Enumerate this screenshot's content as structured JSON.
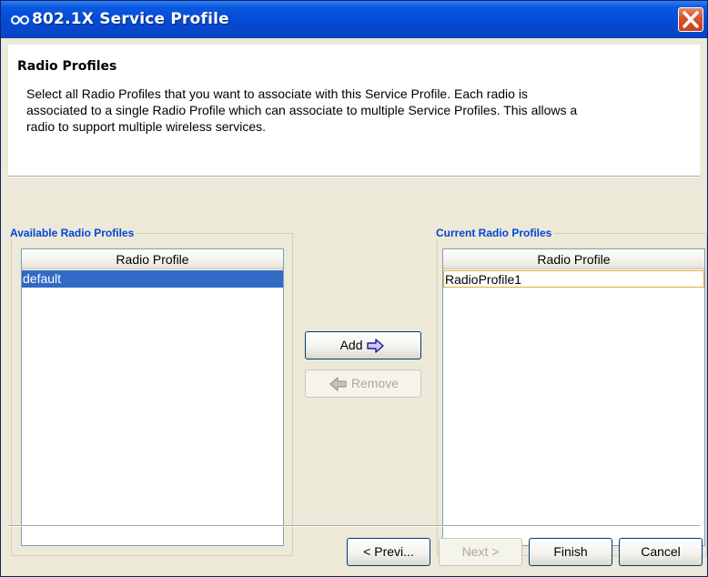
{
  "window": {
    "title": "802.1X Service Profile",
    "app_icon": "glasses-icon",
    "close_icon": "close-icon"
  },
  "header": {
    "title": "Radio Profiles",
    "description": "Select all Radio Profiles that you want to associate with this Service Profile. Each radio is associated to a single Radio Profile which can associate to multiple Service Profiles. This allows a radio to support multiple wireless services."
  },
  "available": {
    "label": "Available Radio Profiles",
    "column_header": "Radio Profile",
    "rows": [
      "default"
    ]
  },
  "current": {
    "label": "Current Radio Profiles",
    "column_header": "Radio Profile",
    "rows": [
      "RadioProfile1"
    ]
  },
  "actions": {
    "add_label": "Add",
    "add_icon": "arrow-right-icon",
    "remove_label": "Remove",
    "remove_icon": "arrow-left-icon"
  },
  "footer": {
    "prev_label": "< Previ...",
    "next_label": "Next >",
    "finish_label": "Finish",
    "cancel_label": "Cancel"
  },
  "colors": {
    "title_bar": "#0548d2",
    "group_label": "#0046d5",
    "selection": "#316ac5",
    "focus_border": "#e8a93c",
    "close_button": "#d9552f"
  }
}
